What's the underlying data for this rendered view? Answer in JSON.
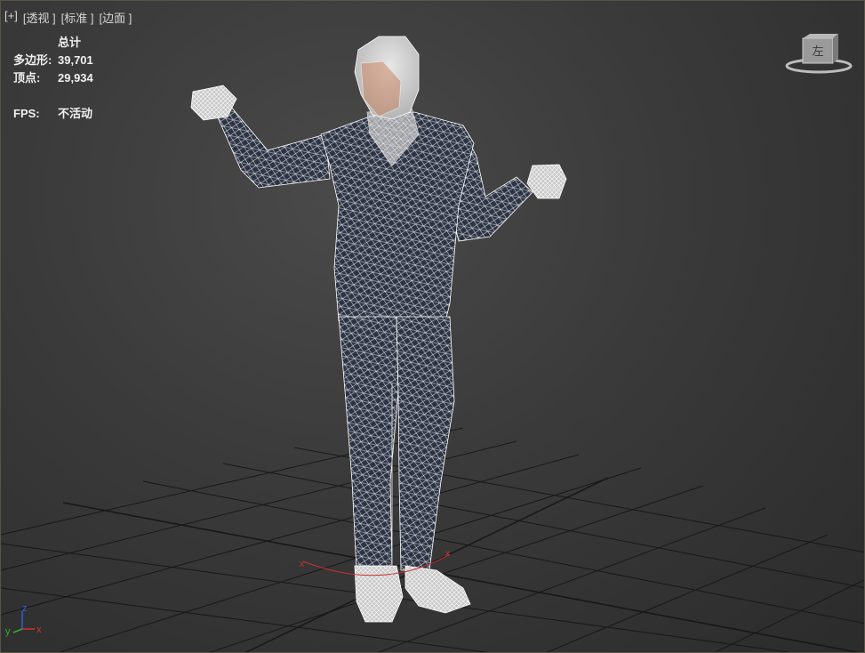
{
  "viewport": {
    "labels": [
      "[+]",
      "[透视 ]",
      "[标准 ]",
      "[边面 ]"
    ]
  },
  "stats": {
    "header": "总计",
    "polygons_label": "多边形:",
    "polygons_value": "39,701",
    "vertices_label": "顶点:",
    "vertices_value": "29,934",
    "fps_label": "FPS:",
    "fps_value": "不活动"
  },
  "viewcube": {
    "label": "左"
  },
  "axis": {
    "x": "x",
    "y": "y",
    "z": "z"
  },
  "colors": {
    "grid": "#151515",
    "wire": "#ffffff",
    "mesh_fill": "#2c3344",
    "axis_x": "#d03030",
    "axis_y": "#30b030",
    "axis_z": "#3060e0"
  }
}
